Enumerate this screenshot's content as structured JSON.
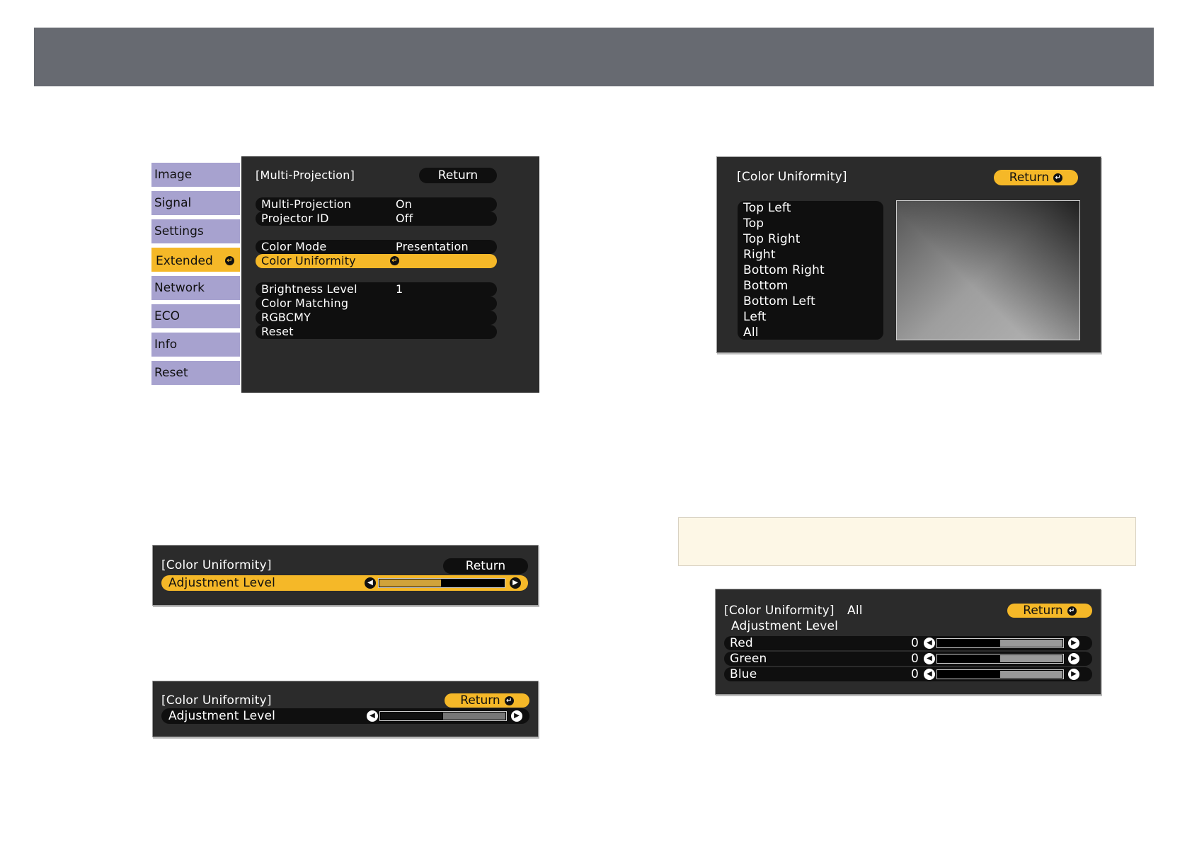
{
  "menu1": {
    "tabs": [
      "Image",
      "Signal",
      "Settings",
      "Extended",
      "Network",
      "ECO",
      "Info",
      "Reset"
    ],
    "title": "[Multi-Projection]",
    "return_label": "Return",
    "rows": [
      {
        "label": "Multi-Projection",
        "value": "On"
      },
      {
        "label": "Projector ID",
        "value": "Off"
      },
      {
        "label": "Color Mode",
        "value": "Presentation"
      },
      {
        "label": "Color Uniformity",
        "value": ""
      },
      {
        "label": "Brightness Level",
        "value": "1"
      },
      {
        "label": "Color Matching",
        "value": ""
      },
      {
        "label": "RGBCMY",
        "value": ""
      },
      {
        "label": "Reset",
        "value": ""
      }
    ]
  },
  "menu2": {
    "title": "[Color Uniformity]",
    "return_label": "Return",
    "areas": [
      "Top Left",
      "Top",
      "Top Right",
      "Right",
      "Bottom Right",
      "Bottom",
      "Bottom Left",
      "Left",
      "All"
    ]
  },
  "menu3": {
    "title": "[Color Uniformity]",
    "return_label": "Return",
    "row_label": "Adjustment Level",
    "level_fraction": 0.5
  },
  "menu4": {
    "title": "[Color Uniformity]",
    "return_label": "Return",
    "row_label": "Adjustment Level",
    "level_fraction": 0.5
  },
  "menu5": {
    "title": "[Color Uniformity]",
    "area": "All",
    "return_label": "Return",
    "subtitle": "Adjustment Level",
    "channels": [
      {
        "label": "Red",
        "value": "0"
      },
      {
        "label": "Green",
        "value": "0"
      },
      {
        "label": "Blue",
        "value": "0"
      }
    ]
  }
}
